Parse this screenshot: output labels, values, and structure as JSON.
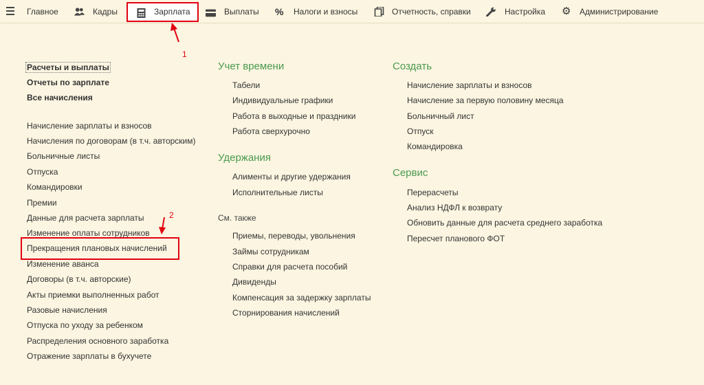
{
  "menu": {
    "tabs": [
      {
        "label": "Главное",
        "icon": "menu-lines-icon"
      },
      {
        "label": "Кадры",
        "icon": "people-icon"
      },
      {
        "label": "Зарплата",
        "icon": "calculator-icon",
        "active": true
      },
      {
        "label": "Выплаты",
        "icon": "wallet-icon"
      },
      {
        "label": "Налоги и взносы",
        "icon": "percent-icon"
      },
      {
        "label": "Отчетность, справки",
        "icon": "documents-icon"
      },
      {
        "label": "Настройка",
        "icon": "wrench-icon"
      },
      {
        "label": "Администрирование",
        "icon": "gear-icon"
      }
    ]
  },
  "left": {
    "top_links": [
      "Расчеты и выплаты",
      "Отчеты по зарплате",
      "Все начисления"
    ],
    "links": [
      "Начисление зарплаты и взносов",
      "Начисления по договорам (в т.ч. авторским)",
      "Больничные листы",
      "Отпуска",
      "Командировки",
      "Премии",
      "Данные для расчета зарплаты",
      "Изменение оплаты сотрудников",
      "Прекращения плановых начислений",
      "Изменение аванса",
      "Договоры (в т.ч. авторские)",
      "Акты приемки выполненных работ",
      "Разовые начисления",
      "Отпуска по уходу за ребенком",
      "Распределения основного заработка",
      "Отражение зарплаты в бухучете"
    ]
  },
  "middle": {
    "time": {
      "title": "Учет времени",
      "items": [
        "Табели",
        "Индивидуальные графики",
        "Работа в выходные и праздники",
        "Работа сверхурочно"
      ]
    },
    "deductions": {
      "title": "Удержания",
      "items": [
        "Алименты и другие удержания",
        "Исполнительные листы"
      ]
    },
    "see_also": {
      "title": "См. также",
      "items": [
        "Приемы, переводы, увольнения",
        "Займы сотрудникам",
        "Справки для расчета пособий",
        "Дивиденды",
        "Компенсация за задержку зарплаты",
        "Сторнирования начислений"
      ]
    }
  },
  "right": {
    "create": {
      "title": "Создать",
      "items": [
        "Начисление зарплаты и взносов",
        "Начисление за первую половину месяца",
        "Больничный лист",
        "Отпуск",
        "Командировка"
      ]
    },
    "service": {
      "title": "Сервис",
      "items": [
        "Перерасчеты",
        "Анализ НДФЛ к возврату",
        "Обновить данные для расчета среднего заработка",
        "Пересчет планового ФОТ"
      ]
    }
  },
  "annotations": {
    "step1": "1",
    "step2": "2",
    "color": "#e1000f"
  },
  "colors": {
    "background": "#fbf5e1",
    "group_title": "#4a9a4f",
    "highlight": "#e1000f"
  }
}
